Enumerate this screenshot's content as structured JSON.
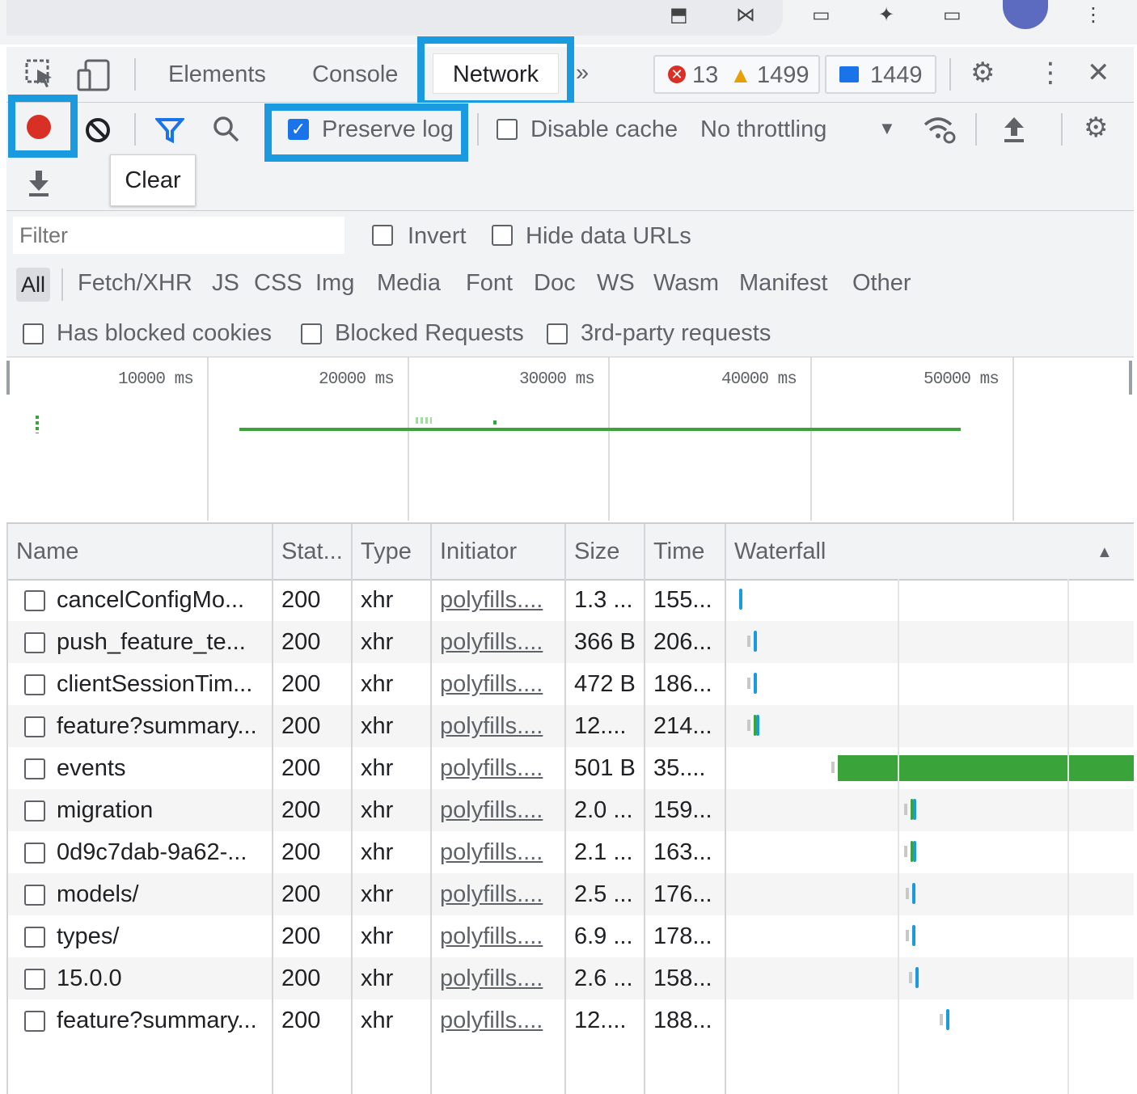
{
  "devtools": {
    "tabs": [
      "Elements",
      "Console",
      "Network"
    ],
    "more_tabs": "»",
    "errors": "13",
    "warnings": "1499",
    "messages": "1449"
  },
  "toolbar": {
    "preserve_log": "Preserve log",
    "disable_cache": "Disable cache",
    "throttling": "No throttling",
    "clear_tooltip": "Clear"
  },
  "filter": {
    "placeholder": "Filter",
    "invert": "Invert",
    "hide_data_urls": "Hide data URLs",
    "types": [
      "All",
      "Fetch/XHR",
      "JS",
      "CSS",
      "Img",
      "Media",
      "Font",
      "Doc",
      "WS",
      "Wasm",
      "Manifest",
      "Other"
    ],
    "has_blocked_cookies": "Has blocked cookies",
    "blocked_requests": "Blocked Requests",
    "third_party": "3rd-party requests"
  },
  "overview": {
    "ticks": [
      "10000 ms",
      "20000 ms",
      "30000 ms",
      "40000 ms",
      "50000 ms"
    ]
  },
  "table": {
    "columns": [
      "Name",
      "Stat...",
      "Type",
      "Initiator",
      "Size",
      "Time",
      "Waterfall"
    ],
    "rows": [
      {
        "name": "cancelConfigMo...",
        "status": "200",
        "type": "xhr",
        "initiator": "polyfills....",
        "size": "1.3 ...",
        "time": "155..."
      },
      {
        "name": "push_feature_te...",
        "status": "200",
        "type": "xhr",
        "initiator": "polyfills....",
        "size": "366 B",
        "time": "206..."
      },
      {
        "name": "clientSessionTim...",
        "status": "200",
        "type": "xhr",
        "initiator": "polyfills....",
        "size": "472 B",
        "time": "186..."
      },
      {
        "name": "feature?summary...",
        "status": "200",
        "type": "xhr",
        "initiator": "polyfills....",
        "size": "12....",
        "time": "214..."
      },
      {
        "name": "events",
        "status": "200",
        "type": "xhr",
        "initiator": "polyfills....",
        "size": "501 B",
        "time": "35...."
      },
      {
        "name": "migration",
        "status": "200",
        "type": "xhr",
        "initiator": "polyfills....",
        "size": "2.0 ...",
        "time": "159..."
      },
      {
        "name": "0d9c7dab-9a62-...",
        "status": "200",
        "type": "xhr",
        "initiator": "polyfills....",
        "size": "2.1 ...",
        "time": "163..."
      },
      {
        "name": "models/",
        "status": "200",
        "type": "xhr",
        "initiator": "polyfills....",
        "size": "2.5 ...",
        "time": "176..."
      },
      {
        "name": "types/",
        "status": "200",
        "type": "xhr",
        "initiator": "polyfills....",
        "size": "6.9 ...",
        "time": "178..."
      },
      {
        "name": "15.0.0",
        "status": "200",
        "type": "xhr",
        "initiator": "polyfills....",
        "size": "2.6 ...",
        "time": "158..."
      },
      {
        "name": "feature?summary...",
        "status": "200",
        "type": "xhr",
        "initiator": "polyfills....",
        "size": "12....",
        "time": "188..."
      }
    ]
  },
  "colors": {
    "highlight": "#1a9be0",
    "record": "#d93025",
    "waiting": "#1a9be0",
    "long_request": "#3aa33a"
  }
}
